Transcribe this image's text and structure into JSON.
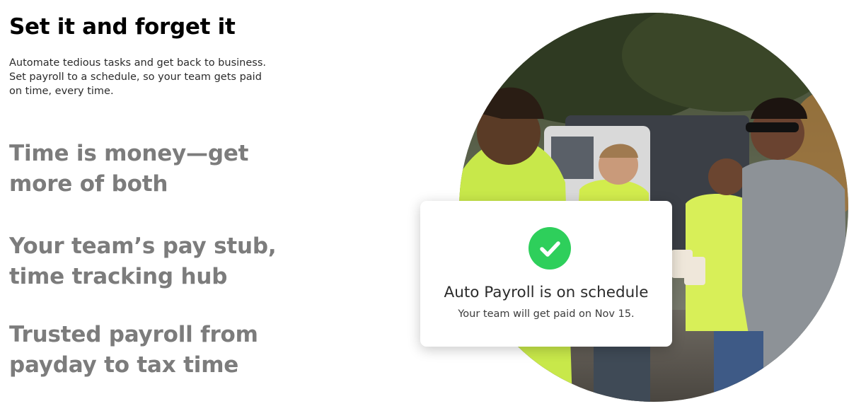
{
  "section": {
    "title": "Set it and forget it",
    "intro": "Automate tedious tasks and get back to business. Set payroll to a schedule, so your team gets paid on time, every time."
  },
  "feature_tabs": [
    {
      "label": "Time is money—get more of both"
    },
    {
      "label": "Your team’s pay stub, time tracking hub"
    },
    {
      "label": "Trusted payroll from payday to tax time"
    }
  ],
  "notification": {
    "icon": "checkmark-icon",
    "title": "Auto Payroll is on schedule",
    "message": "Your team will get paid on Nov 15."
  },
  "colors": {
    "success": "#2ecf5b",
    "tab_text": "#7c7c7c",
    "heading": "#000000"
  }
}
